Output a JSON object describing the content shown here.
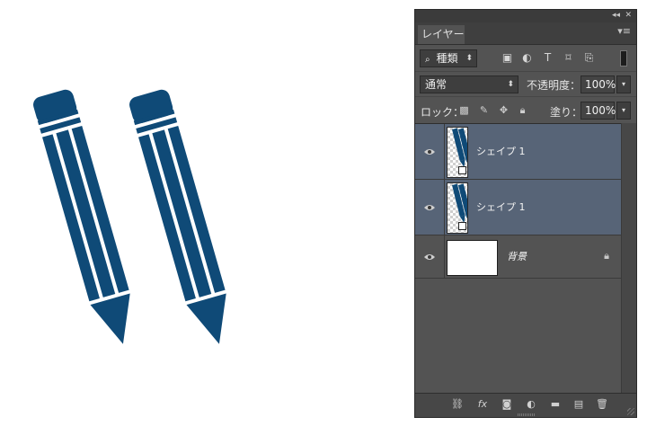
{
  "canvas": {
    "shape_color": "#0f4a77"
  },
  "panel": {
    "collapse_icon": "double-chevron-right",
    "tab_label": "レイヤー",
    "filter": {
      "kind_label": "種類"
    },
    "blend": {
      "mode": "通常",
      "opacity_label": "不透明度：",
      "opacity_value": "100%"
    },
    "lock": {
      "label": "ロック：",
      "fill_label": "塗り：",
      "fill_value": "100%"
    },
    "layers": [
      {
        "name": "シェイプ 1",
        "selected": true,
        "visible": true
      },
      {
        "name": "シェイプ 1",
        "selected": true,
        "visible": true
      },
      {
        "name": "背景",
        "selected": false,
        "visible": true,
        "locked": true
      }
    ]
  }
}
